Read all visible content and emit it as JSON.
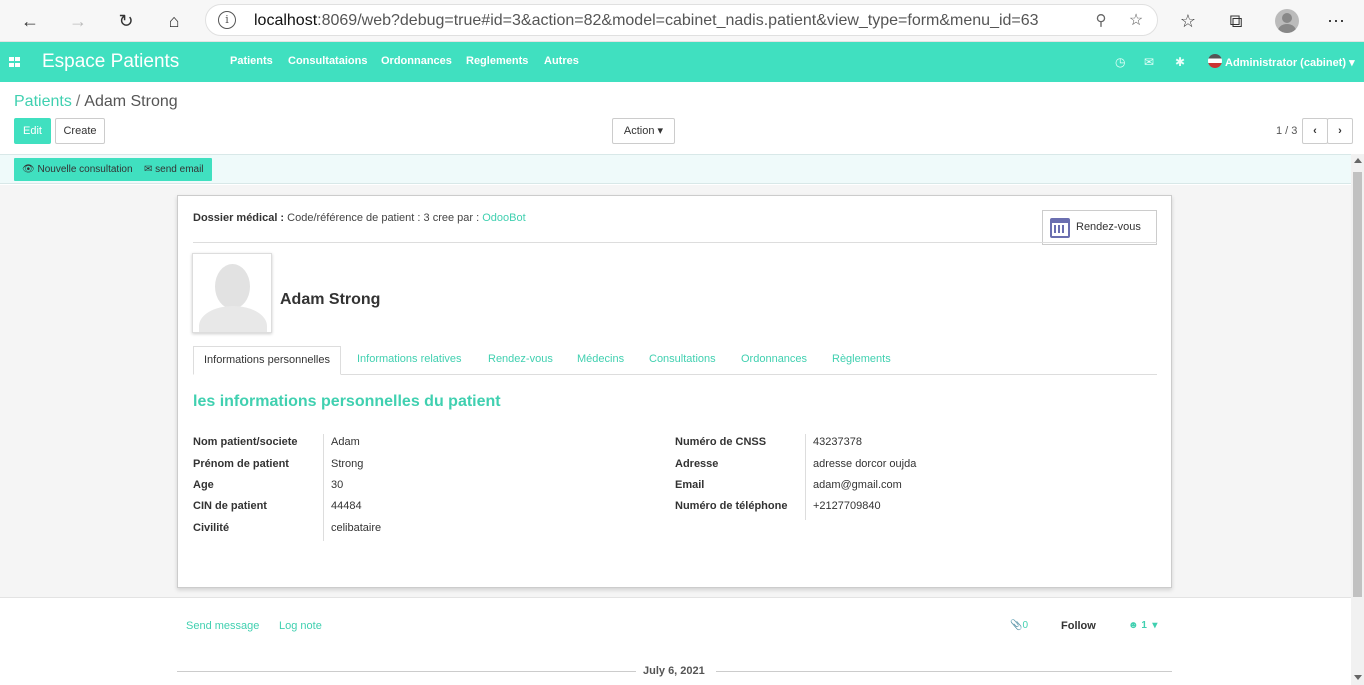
{
  "browser": {
    "url_host": "localhost",
    "url_rest": ":8069/web?debug=true#id=3&action=82&model=cabinet_nadis.patient&view_type=form&menu_id=63"
  },
  "navbar": {
    "brand": "Espace Patients",
    "menu": [
      "Patients",
      "Consultataions",
      "Ordonnances",
      "Reglements",
      "Autres"
    ],
    "user": "Administrator (cabinet)",
    "accent_color": "#40e0c0"
  },
  "breadcrumb": {
    "parent": "Patients",
    "separator": "/",
    "current": "Adam Strong"
  },
  "control_panel": {
    "edit_label": "Edit",
    "create_label": "Create",
    "action_label": "Action",
    "pager": "1 / 3"
  },
  "statusbar": {
    "nouvelle_consultation": "Nouvelle consultation",
    "send_email": "send email"
  },
  "sheet": {
    "dossier_label": "Dossier médical :",
    "dossier_text": " Code/référence de patient : 3 cree par : ",
    "dossier_user": "OdooBot",
    "rendez_vous_button": "Rendez-vous",
    "patient_name": "Adam Strong",
    "tabs": [
      "Informations personnelles",
      "Informations relatives",
      "Rendez-vous",
      "Médecins",
      "Consultations",
      "Ordonnances",
      "Règlements"
    ],
    "section_title": "les informations personnelles du patient",
    "left_fields": [
      {
        "label": "Nom patient/societe",
        "value": "Adam"
      },
      {
        "label": "Prénom de patient",
        "value": "Strong"
      },
      {
        "label": "Age",
        "value": "30"
      },
      {
        "label": "CIN de patient",
        "value": "44484"
      },
      {
        "label": "Civilité",
        "value": "celibataire"
      }
    ],
    "right_fields": [
      {
        "label": "Numéro de CNSS",
        "value": "43237378"
      },
      {
        "label": "Adresse",
        "value": "adresse dorcor oujda"
      },
      {
        "label": "Email",
        "value": "adam@gmail.com"
      },
      {
        "label": "Numéro de téléphone",
        "value": "+2127709840"
      }
    ]
  },
  "chatter": {
    "send_message": "Send message",
    "log_note": "Log note",
    "attachments_count": "0",
    "follow": "Follow",
    "followers_count": "1",
    "date": "July 6, 2021"
  }
}
